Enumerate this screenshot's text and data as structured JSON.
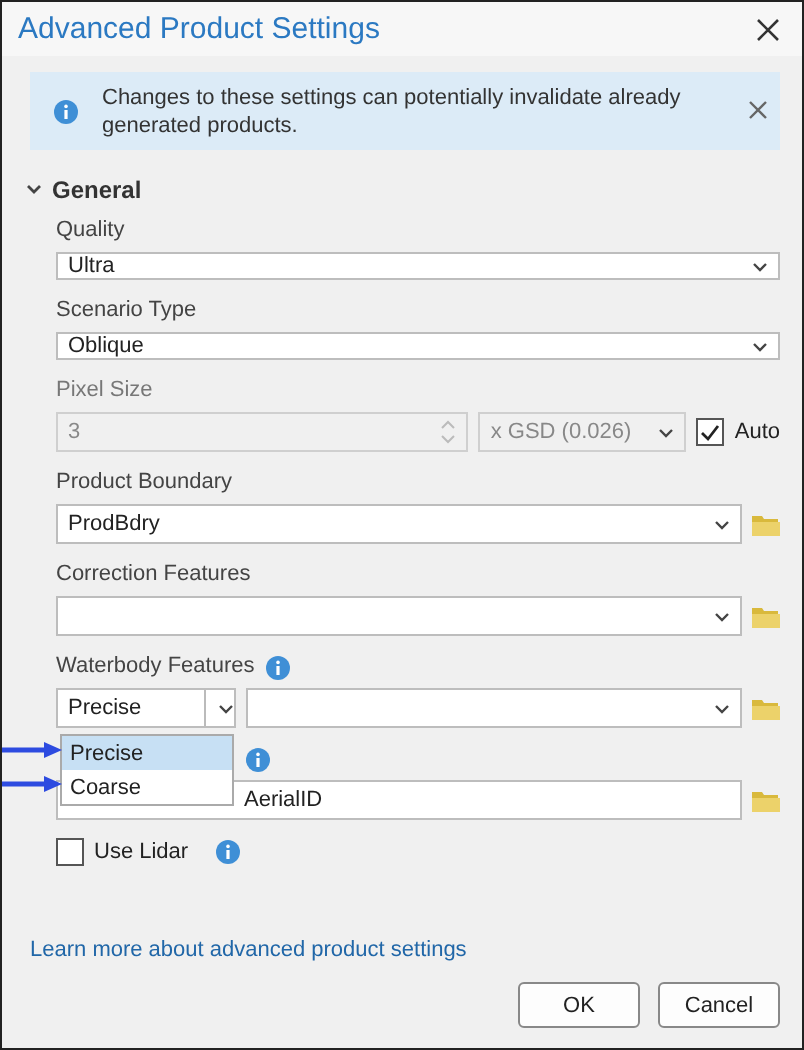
{
  "window": {
    "title": "Advanced Product Settings"
  },
  "notice": {
    "text": "Changes to these settings can potentially invalidate already generated products."
  },
  "section": {
    "label": "General",
    "expanded": true
  },
  "fields": [
    {
      "kind": "select",
      "label": "Quality",
      "value": "Ultra"
    },
    {
      "kind": "select",
      "label": "Scenario Type",
      "value": "Oblique"
    },
    {
      "kind": "pixel",
      "label": "Pixel Size",
      "value": "3",
      "unit": "x GSD (0.026)",
      "disabled": true,
      "auto_label": "Auto",
      "auto_checked": true
    },
    {
      "kind": "layer",
      "label": "Product Boundary",
      "value": "ProdBdry"
    },
    {
      "kind": "layer",
      "label": "Correction Features"
    },
    {
      "kind": "waterbody",
      "label": "Waterbody Features",
      "info": true,
      "mode": "Precise",
      "menu": [
        {
          "label": "Precise",
          "selected": true
        },
        {
          "label": "Coarse",
          "selected": false
        }
      ]
    },
    {
      "kind": "path",
      "info": true,
      "value": "AerialID"
    },
    {
      "kind": "checkbox",
      "label": "Use Lidar",
      "info": true,
      "checked": false
    }
  ],
  "link": "Learn more about advanced product settings",
  "buttons": [
    "OK",
    "Cancel"
  ]
}
